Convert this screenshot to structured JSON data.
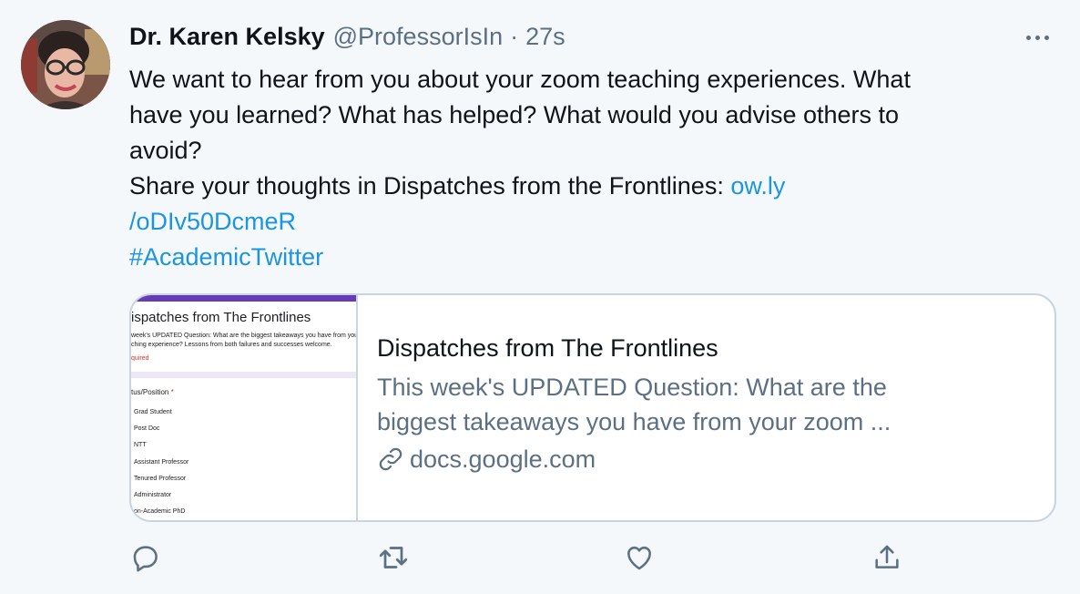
{
  "tweet": {
    "author_name": "Dr. Karen Kelsky",
    "handle": "@ProfessorIsIn",
    "separator": "·",
    "time": "27s",
    "body_lines": [
      "We want to hear from you about your zoom teaching experiences. What",
      "have you learned? What has helped? What would you advise others to",
      "avoid?"
    ],
    "share_text": "Share your thoughts in Dispatches from the Frontlines: ",
    "link_part1": "ow.ly",
    "link_part2": "/oDIv50DcmeR",
    "hashtag": "#AcademicTwitter"
  },
  "card": {
    "title": "Dispatches from The Frontlines",
    "desc_line1": "This week's UPDATED Question: What are the",
    "desc_line2": "biggest takeaways you have from your zoom ...",
    "domain": "docs.google.com",
    "thumbnail": {
      "title": "ispatches from The Frontlines",
      "desc_line1": "week's UPDATED Question: What are the biggest takeaways you have from your zoom",
      "desc_line2": "ching experience? Lessons from both failures and successes welcome.",
      "required": "quired",
      "question": "tus/Position",
      "required_star": "*",
      "options": [
        "Grad Student",
        "Post Doc",
        "NTT",
        "Assistant Professor",
        "Tenured Professor",
        "Administrator",
        "on-Academic PhD"
      ]
    }
  },
  "colors": {
    "link": "#1b95e0",
    "secondary_text": "#5b7083",
    "form_accent": "#673ab7"
  },
  "icons": [
    "more-icon",
    "reply-icon",
    "retweet-icon",
    "like-icon",
    "share-icon",
    "link-icon"
  ]
}
